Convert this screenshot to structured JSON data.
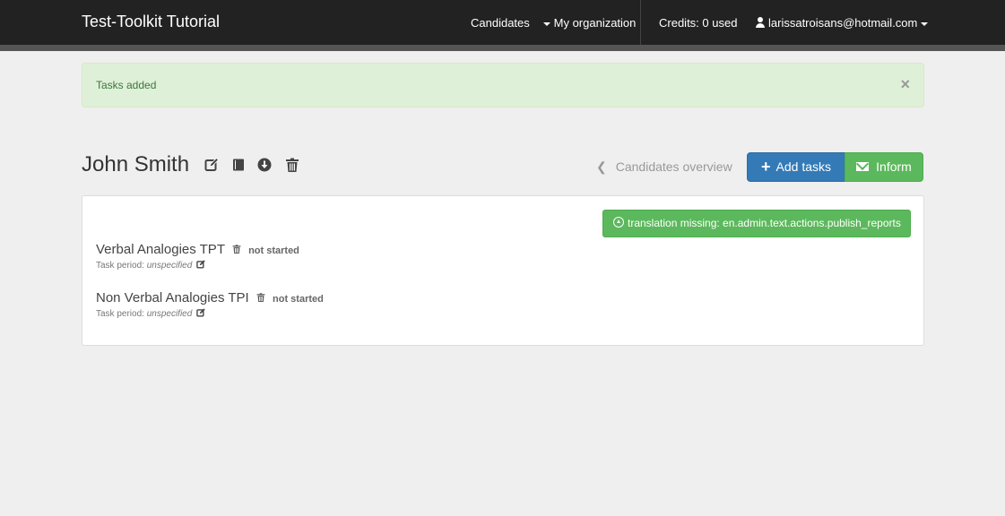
{
  "navbar": {
    "brand": "Test-Toolkit Tutorial",
    "candidates": "Candidates",
    "organization": "My organization",
    "credits": "Credits: 0 used",
    "user_email": "larissatroisans@hotmail.com"
  },
  "alert": {
    "message": "Tasks added",
    "close": "×"
  },
  "header": {
    "candidate_name": "John Smith",
    "overview_link": "Candidates overview",
    "add_tasks": "Add tasks",
    "inform": "Inform"
  },
  "panel": {
    "publish_button": "translation missing: en.admin.text.actions.publish_reports",
    "tasks": [
      {
        "name": "Verbal Analogies TPT",
        "status": "not started",
        "period_label": "Task period:",
        "period_value": "unspecified"
      },
      {
        "name": "Non Verbal Analogies TPI",
        "status": "not started",
        "period_label": "Task period:",
        "period_value": "unspecified"
      }
    ]
  },
  "colors": {
    "navbar": "#222222",
    "alert_bg": "#dff0d8",
    "primary": "#337ab7",
    "success": "#5cb85c"
  }
}
